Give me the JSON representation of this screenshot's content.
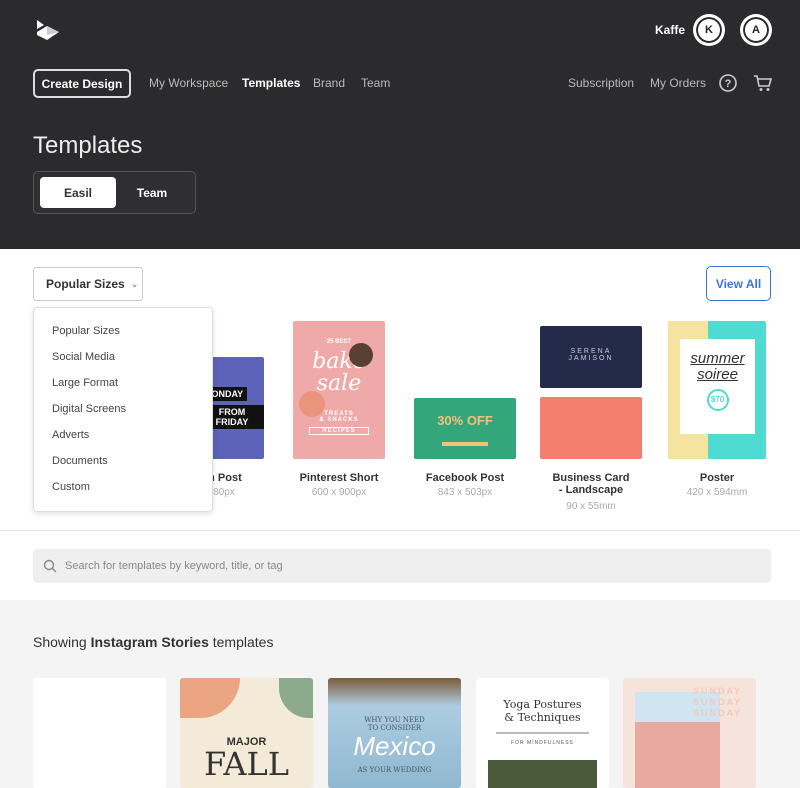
{
  "header": {
    "user_name": "Kaffe",
    "avatars": [
      "K",
      "A"
    ],
    "create_button": "Create Design",
    "nav": [
      "My Workspace",
      "Templates",
      "Brand",
      "Team"
    ],
    "active_nav": "Templates",
    "right_nav": [
      "Subscription",
      "My Orders"
    ],
    "icons": [
      "help-icon",
      "cart-icon"
    ],
    "page_title": "Templates",
    "toggle": [
      "Easil",
      "Team"
    ],
    "active_toggle": "Easil"
  },
  "sizes": {
    "selector": "Popular Sizes",
    "view_all": "View All",
    "dropdown": [
      "Popular Sizes",
      "Social Media",
      "Large Format",
      "Digital Screens",
      "Adverts",
      "Documents",
      "Custom"
    ],
    "items": [
      {
        "label": "Instagram Post",
        "size": "1080 x 1080px",
        "thumb_text": [
          "MONDAY",
          "FROM FRIDAY"
        ]
      },
      {
        "label": "Pinterest Short",
        "size": "600 x 900px",
        "thumb_text": [
          "25 BEST",
          "bake sale",
          "TREATS",
          "& SNACKS",
          "RECIPES"
        ]
      },
      {
        "label": "Facebook Post",
        "size": "843 x 503px",
        "thumb_text": [
          "30% OFF"
        ]
      },
      {
        "label": "Business Card - Landscape",
        "size": "90 x 55mm",
        "thumb_text": [
          "SERENA",
          "JAMISON"
        ]
      },
      {
        "label": "Poster",
        "size": "420 x 594mm",
        "thumb_text": [
          "summer",
          "soiree",
          "$70"
        ]
      }
    ]
  },
  "search": {
    "placeholder": "Search for templates by keyword, title, or tag"
  },
  "results": {
    "prefix": "Showing ",
    "category": "Instagram Stories",
    "suffix": " templates",
    "cards": [
      {
        "text": []
      },
      {
        "text": [
          "MAJOR",
          "FALL"
        ]
      },
      {
        "text": [
          "WHY YOU NEED",
          "TO CONSIDER",
          "Mexico",
          "AS YOUR WEDDING"
        ]
      },
      {
        "text": [
          "Yoga Postures",
          "& Techniques",
          "FOR MINDFULNESS"
        ]
      },
      {
        "text": [
          "SUNDAY",
          "SUNDAY",
          "SUNDAY"
        ]
      }
    ]
  },
  "colors": {
    "header_bg": "#2b2b2d",
    "accent": "#3a76d8"
  }
}
